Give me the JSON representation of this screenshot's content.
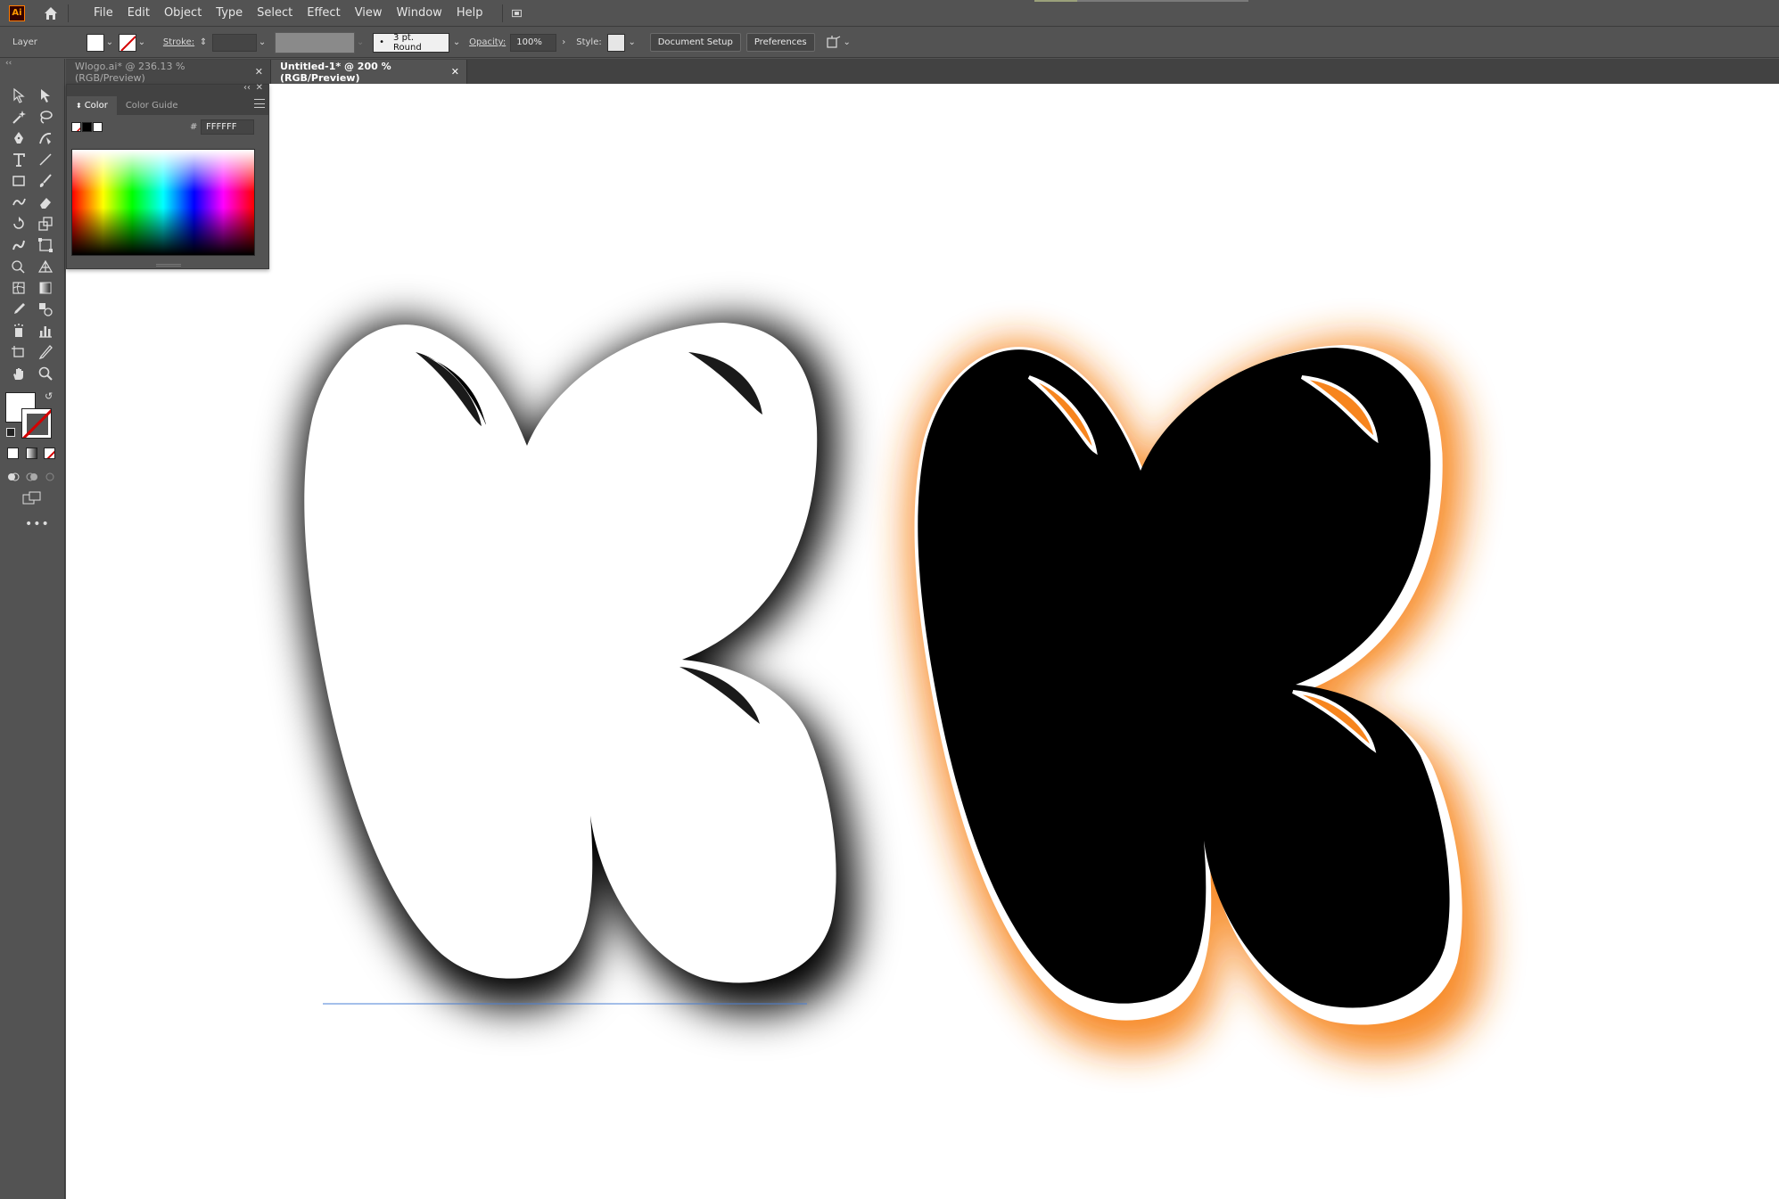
{
  "app": {
    "logo_text": "Ai",
    "menu": [
      "File",
      "Edit",
      "Object",
      "Type",
      "Select",
      "Effect",
      "View",
      "Window",
      "Help"
    ]
  },
  "control_bar": {
    "selection_label": "Layer",
    "stroke_label": "Stroke:",
    "brush_value": "3 pt. Round",
    "opacity_label": "Opacity:",
    "opacity_value": "100%",
    "style_label": "Style:",
    "document_setup_label": "Document Setup",
    "preferences_label": "Preferences"
  },
  "tabs": [
    {
      "label": "Wlogo.ai* @ 236.13 % (RGB/Preview)",
      "active": false
    },
    {
      "label": "Untitled-1* @ 200 % (RGB/Preview)",
      "active": true
    }
  ],
  "color_panel": {
    "tabs": [
      "Color",
      "Color Guide"
    ],
    "hex_label": "#",
    "hex_value": "FFFFFF"
  },
  "colors": {
    "accent_orange": "#f7851e",
    "fill_white": "#ffffff",
    "letter_black": "#000000",
    "guide_blue": "#4a7fd4"
  }
}
